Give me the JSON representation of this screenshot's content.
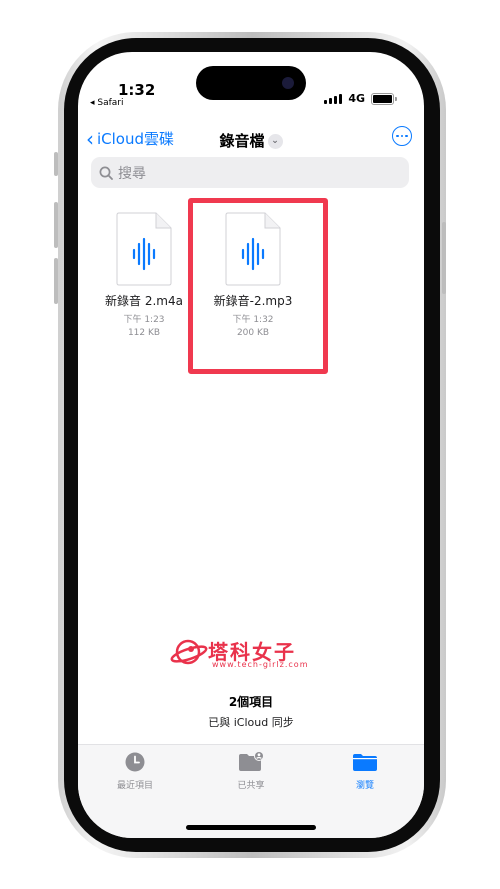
{
  "status_bar": {
    "time": "1:32",
    "back_app": "Safari",
    "network": "4G"
  },
  "nav": {
    "back_label": "iCloud雲碟",
    "title": "錄音檔"
  },
  "search": {
    "placeholder": "搜尋"
  },
  "files": [
    {
      "name": "新錄音 2.m4a",
      "time": "下午 1:23",
      "size": "112 KB"
    },
    {
      "name": "新錄音-2.mp3",
      "time": "下午 1:32",
      "size": "200 KB"
    }
  ],
  "watermark": {
    "text": "塔科女子",
    "url": "www.tech-girlz.com"
  },
  "footer": {
    "item_count": "2個項目",
    "sync_status": "已與 iCloud 同步"
  },
  "tabs": [
    {
      "label": "最近項目",
      "icon": "clock-icon",
      "active": false
    },
    {
      "label": "已共享",
      "icon": "shared-folder-icon",
      "active": false
    },
    {
      "label": "瀏覽",
      "icon": "folder-icon",
      "active": true
    }
  ],
  "colors": {
    "accent": "#0a7aff",
    "highlight": "#f0394f",
    "watermark": "#e9324b"
  }
}
